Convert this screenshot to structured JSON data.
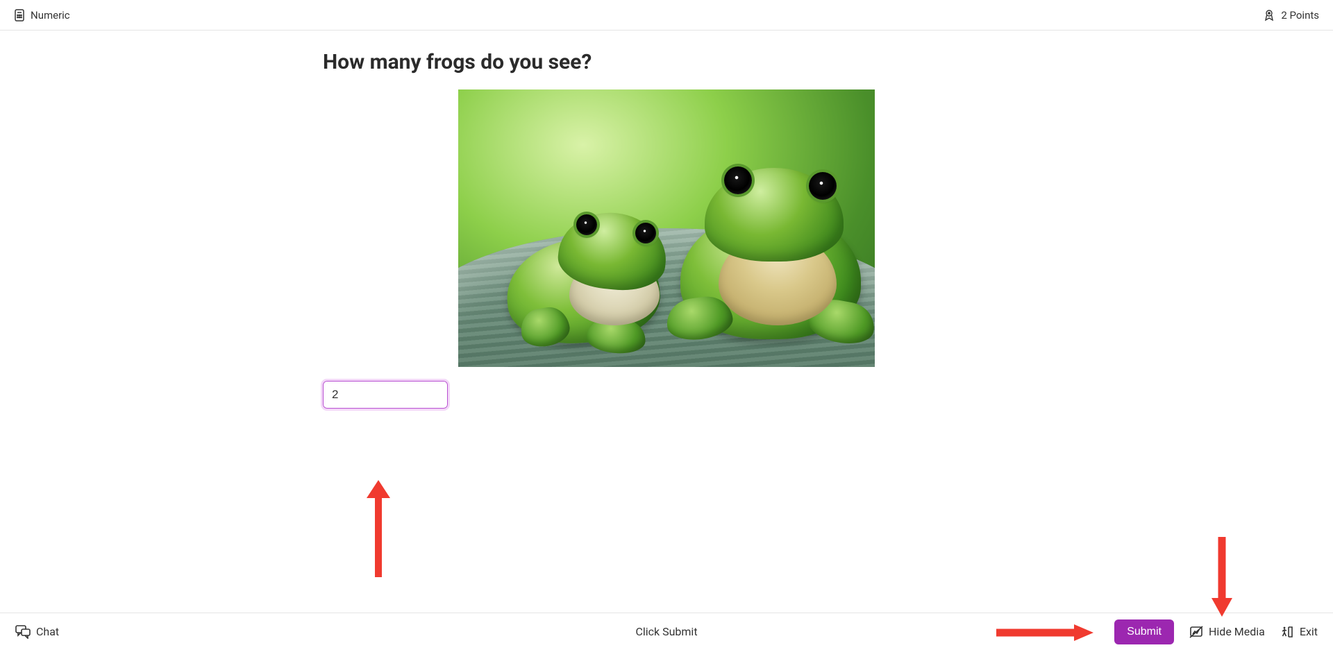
{
  "topbar": {
    "type_label": "Numeric",
    "points_label": "2 Points"
  },
  "question": {
    "title": "How many frogs do you see?",
    "image_alt": "Two green frogs on a leaf",
    "answer_value": "2"
  },
  "bottombar": {
    "chat_label": "Chat",
    "center_text": "Click Submit",
    "submit_label": "Submit",
    "hide_media_label": "Hide Media",
    "exit_label": "Exit"
  },
  "annotations": {
    "arrow_to_input": true,
    "arrow_to_submit_horizontal": true,
    "arrow_to_submit_vertical": true
  }
}
